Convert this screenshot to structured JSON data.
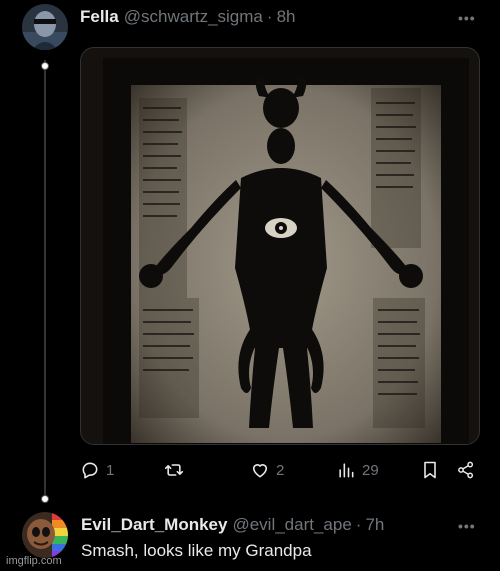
{
  "post": {
    "display_name": "Fella",
    "handle": "@schwartz_sigma",
    "separator": "·",
    "time": "8h",
    "more_icon": "more-horizontal-icon",
    "media_alt": "Dark occult manuscript illustration of a multi-armed figure with an eye on its chest, flanked by columns of script",
    "actions": {
      "replies": "1",
      "reposts": "",
      "likes": "2",
      "views": "29"
    }
  },
  "reply": {
    "display_name": "Evil_Dart_Monkey",
    "handle": "@evil_dart_ape",
    "separator": "·",
    "time": "7h",
    "text": "Smash, looks like my Grandpa"
  },
  "watermark": "imgflip.com",
  "colors": {
    "background": "#000000",
    "text_primary": "#e7e9ea",
    "text_secondary": "#71767b",
    "border": "#2f3336"
  }
}
